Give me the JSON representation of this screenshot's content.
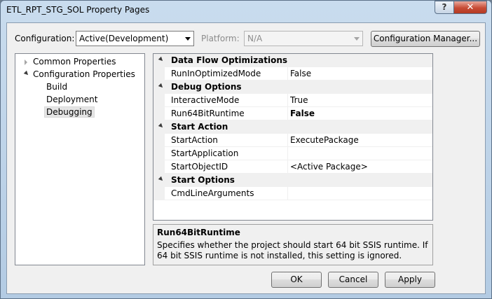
{
  "window": {
    "title": "ETL_RPT_STG_SOL Property Pages",
    "help_label": "?",
    "close_label": "✕"
  },
  "toolbar": {
    "configuration_label": "Configuration:",
    "configuration_value": "Active(Development)",
    "platform_label": "Platform:",
    "platform_value": "N/A",
    "config_manager_label": "Configuration Manager..."
  },
  "tree": {
    "items": [
      {
        "label": "Common Properties",
        "expanded": false
      },
      {
        "label": "Configuration Properties",
        "expanded": true
      },
      {
        "label": "Build"
      },
      {
        "label": "Deployment"
      },
      {
        "label": "Debugging",
        "selected": true
      }
    ]
  },
  "grid": {
    "categories": [
      {
        "name": "Data Flow Optimizations",
        "properties": [
          {
            "name": "RunInOptimizedMode",
            "value": "False"
          }
        ]
      },
      {
        "name": "Debug Options",
        "properties": [
          {
            "name": "InteractiveMode",
            "value": "True"
          },
          {
            "name": "Run64BitRuntime",
            "value": "False",
            "bold": true
          }
        ]
      },
      {
        "name": "Start Action",
        "properties": [
          {
            "name": "StartAction",
            "value": "ExecutePackage"
          },
          {
            "name": "StartApplication",
            "value": ""
          },
          {
            "name": "StartObjectID",
            "value": "<Active Package>"
          }
        ]
      },
      {
        "name": "Start Options",
        "properties": [
          {
            "name": "CmdLineArguments",
            "value": ""
          }
        ]
      }
    ]
  },
  "description": {
    "title": "Run64BitRuntime",
    "text": "Specifies whether the project should start 64 bit SSIS runtime. If 64 bit SSIS runtime is not installed, this setting is ignored."
  },
  "buttons": {
    "ok": "OK",
    "cancel": "Cancel",
    "apply": "Apply"
  },
  "colors": {
    "title_bar": "#c9dcee",
    "close_button": "#c74b35",
    "dialog_background": "#f0f0f0"
  }
}
